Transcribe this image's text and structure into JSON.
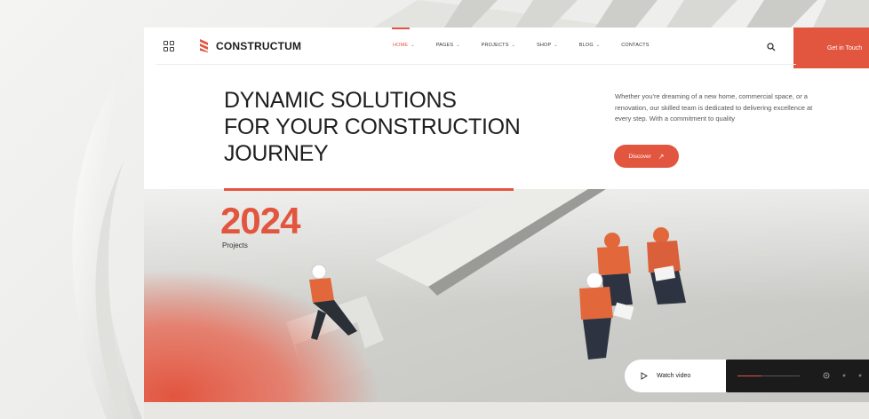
{
  "brand": {
    "name": "CONSTRUCTUM",
    "accent": "#e2553f"
  },
  "nav": {
    "items": [
      {
        "label": "HOME",
        "active": true,
        "has_dropdown": true
      },
      {
        "label": "PAGES",
        "active": false,
        "has_dropdown": true
      },
      {
        "label": "PROJECTS",
        "active": false,
        "has_dropdown": true
      },
      {
        "label": "SHOP",
        "active": false,
        "has_dropdown": true
      },
      {
        "label": "BLOG",
        "active": false,
        "has_dropdown": true
      },
      {
        "label": "CONTACTS",
        "active": false,
        "has_dropdown": false
      }
    ],
    "cta_label": "Get in Touch",
    "icons": [
      "grid-icon",
      "search-icon"
    ]
  },
  "hero": {
    "headline": [
      "DYNAMIC SOLUTIONS",
      "FOR YOUR CONSTRUCTION",
      "JOURNEY"
    ],
    "intro": "Whether you're dreaming of a new home, commercial space, or a renovation, our skilled team is dedicated to delivering excellence at every step. With a commitment to quality",
    "discover_label": "Discover",
    "stat_value": "2024",
    "stat_label": "Projects"
  },
  "video": {
    "watch_label": "Watch video",
    "progress": 0.38
  }
}
